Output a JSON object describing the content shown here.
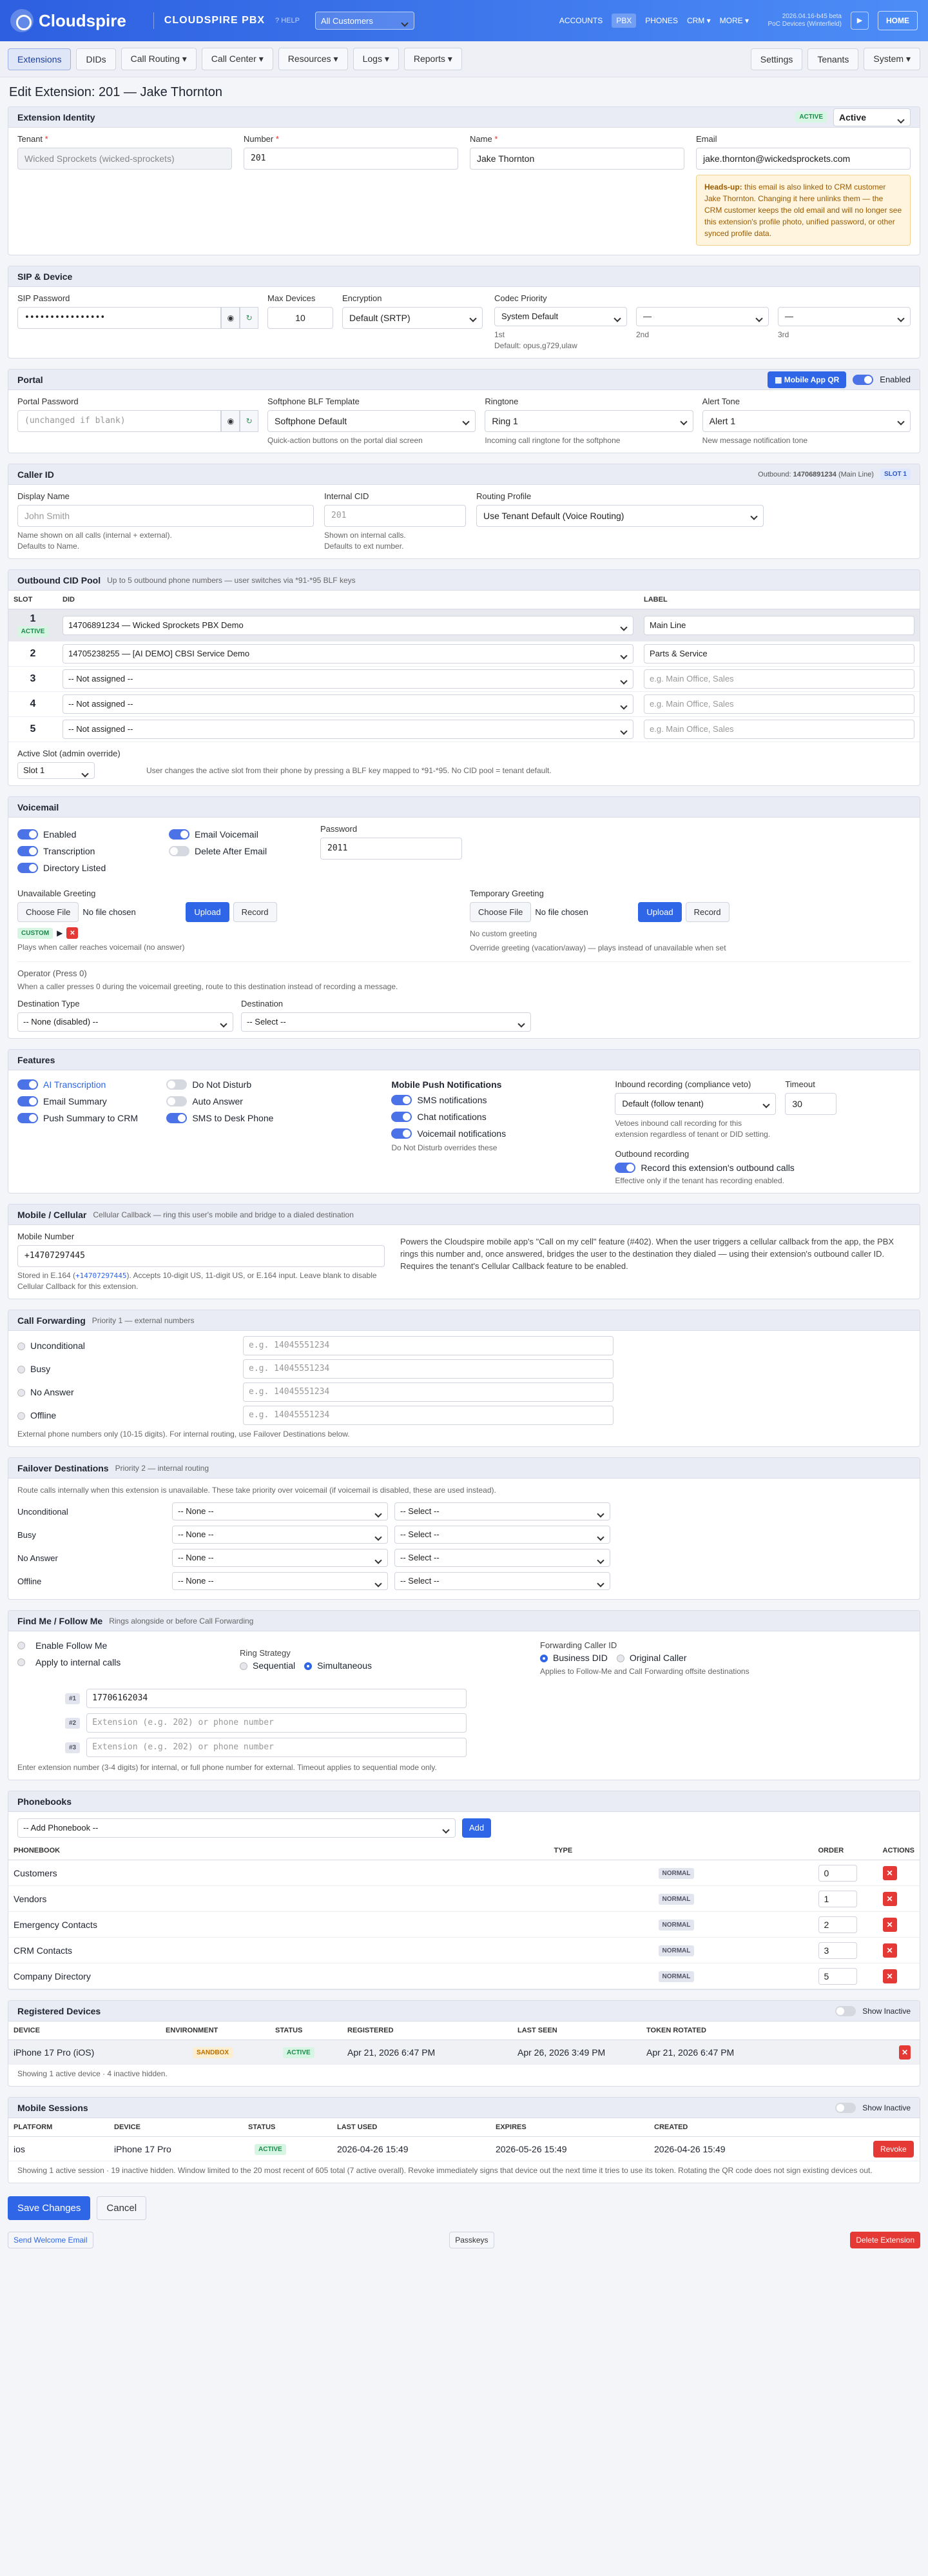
{
  "topbar": {
    "logo": "Cloudspire",
    "app": "CLOUDSPIRE PBX",
    "help": "? HELP",
    "customer": "All Customers",
    "nav": [
      "ACCOUNTS",
      "PBX",
      "PHONES",
      "CRM ▾",
      "MORE ▾"
    ],
    "version_line1": "2026.04.16-b45 beta",
    "version_line2": "PoC Devices (Winterfield)",
    "home": "HOME"
  },
  "subnav": {
    "left": [
      "Extensions",
      "DIDs",
      "Call Routing ▾",
      "Call Center ▾",
      "Resources ▾",
      "Logs ▾",
      "Reports ▾"
    ],
    "right": [
      "Settings",
      "Tenants",
      "System ▾"
    ]
  },
  "page_title": "Edit Extension: 201 — Jake Thornton",
  "identity": {
    "title": "Extension Identity",
    "status_badge": "ACTIVE",
    "status_value": "Active",
    "tenant_label": "Tenant",
    "tenant_value": "Wicked Sprockets (wicked-sprockets)",
    "number_label": "Number",
    "number_value": "201",
    "name_label": "Name",
    "name_value": "Jake Thornton",
    "email_label": "Email",
    "email_value": "jake.thornton@wickedsprockets.com",
    "warn_lead": "Heads-up:",
    "warn_text": "this email is also linked to CRM customer Jake Thornton. Changing it here unlinks them — the CRM customer keeps the old email and will no longer see this extension's profile photo, unified password, or other synced profile data."
  },
  "sip": {
    "title": "SIP & Device",
    "pwd_label": "SIP Password",
    "pwd_value": "••••••••••••••••",
    "max_label": "Max Devices",
    "max_value": "10",
    "enc_label": "Encryption",
    "enc_value": "Default (SRTP)",
    "codec_label": "Codec Priority",
    "codec1": "System Default",
    "codec2": "—",
    "codec3": "—",
    "c1": "1st",
    "c2": "2nd",
    "c3": "3rd",
    "codec_default": "Default: opus,g729,ulaw"
  },
  "portal": {
    "title": "Portal",
    "qr": "Mobile App QR",
    "enabled": "Enabled",
    "pwd_label": "Portal Password",
    "pwd_ph": "(unchanged if blank)",
    "blf_label": "Softphone BLF Template",
    "blf_value": "Softphone Default",
    "blf_hint": "Quick-action buttons on the portal dial screen",
    "ring_label": "Ringtone",
    "ring_value": "Ring 1",
    "ring_hint": "Incoming call ringtone for the softphone",
    "alert_label": "Alert Tone",
    "alert_value": "Alert 1",
    "alert_hint": "New message notification tone"
  },
  "callerid": {
    "title": "Caller ID",
    "outbound_prefix": "Outbound:",
    "outbound_num": "14706891234",
    "outbound_suffix": "(Main Line)",
    "slot": "SLOT 1",
    "disp_label": "Display Name",
    "disp_ph": "John Smith",
    "disp_hint1": "Name shown on all calls (internal + external).",
    "disp_hint2": "Defaults to Name.",
    "int_label": "Internal CID",
    "int_ph": "201",
    "int_hint1": "Shown on internal calls.",
    "int_hint2": "Defaults to ext number.",
    "route_label": "Routing Profile",
    "route_value": "Use Tenant Default (Voice Routing)"
  },
  "cidpool": {
    "title": "Outbound CID Pool",
    "subtitle": "Up to 5 outbound phone numbers — user switches via *91-*95 BLF keys",
    "headers": [
      "SLOT",
      "DID",
      "LABEL"
    ],
    "active_badge": "ACTIVE",
    "rows": [
      {
        "slot": "1",
        "did": "14706891234 — Wicked Sprockets PBX Demo",
        "label": "Main Line",
        "ph": false
      },
      {
        "slot": "2",
        "did": "14705238255 — [AI DEMO] CBSI Service Demo",
        "label": "Parts & Service",
        "ph": false
      },
      {
        "slot": "3",
        "did": "-- Not assigned --",
        "label": "e.g. Main Office, Sales",
        "ph": true
      },
      {
        "slot": "4",
        "did": "-- Not assigned --",
        "label": "e.g. Main Office, Sales",
        "ph": true
      },
      {
        "slot": "5",
        "did": "-- Not assigned --",
        "label": "e.g. Main Office, Sales",
        "ph": true
      }
    ],
    "active_label": "Active Slot (admin override)",
    "active_value": "Slot 1",
    "active_hint": "User changes the active slot from their phone by pressing a BLF key mapped to *91-*95. No CID pool = tenant default."
  },
  "voicemail": {
    "title": "Voicemail",
    "t_enabled": "Enabled",
    "t_trans": "Transcription",
    "t_dir": "Directory Listed",
    "t_email": "Email Voicemail",
    "t_delete": "Delete After Email",
    "pwd_label": "Password",
    "pwd_value": "2011",
    "un_label": "Unavailable Greeting",
    "choose": "Choose File",
    "nofile": "No file chosen",
    "upload": "Upload",
    "record": "Record",
    "custom": "CUSTOM",
    "un_hint": "Plays when caller reaches voicemail (no answer)",
    "tmp_label": "Temporary Greeting",
    "tmp_none": "No custom greeting",
    "tmp_hint": "Override greeting (vacation/away) — plays instead of unavailable when set",
    "op_title": "Operator (Press 0)",
    "op_hint": "When a caller presses 0 during the voicemail greeting, route to this destination instead of recording a message.",
    "dt_label": "Destination Type",
    "dt_value": "-- None (disabled) --",
    "d_label": "Destination",
    "d_value": "-- Select --"
  },
  "features": {
    "title": "Features",
    "f_ai": "AI Transcription",
    "f_summary": "Email Summary",
    "f_push": "Push Summary to CRM",
    "f_dnd": "Do Not Disturb",
    "f_auto": "Auto Answer",
    "f_sms": "SMS to Desk Phone",
    "mp_title": "Mobile Push Notifications",
    "mp_sms": "SMS notifications",
    "mp_chat": "Chat notifications",
    "mp_vm": "Voicemail notifications",
    "mp_hint": "Do Not Disturb overrides these",
    "ir_label": "Inbound recording (compliance veto)",
    "ir_value": "Default (follow tenant)",
    "ir_hint": "Vetoes inbound call recording for this extension regardless of tenant or DID setting.",
    "to_label": "Timeout",
    "to_value": "30",
    "or_label": "Outbound recording",
    "or_toggle": "Record this extension's outbound calls",
    "or_hint": "Effective only if the tenant has recording enabled."
  },
  "mobile": {
    "title": "Mobile / Cellular",
    "subtitle": "Cellular Callback — ring this user's mobile and bridge to a dialed destination",
    "num_label": "Mobile Number",
    "num_value": "+14707297445",
    "stored_a": "Stored in E.164 (",
    "stored_code": "+14707297445",
    "stored_b": "). Accepts 10-digit US, 11-digit US, or E.164 input. Leave blank to disable Cellular Callback for this extension.",
    "desc": "Powers the Cloudspire mobile app's \"Call on my cell\" feature (#402). When the user triggers a cellular callback from the app, the PBX rings this number and, once answered, bridges the user to the destination they dialed — using their extension's outbound caller ID. Requires the tenant's Cellular Callback feature to be enabled."
  },
  "forwarding": {
    "title": "Call Forwarding",
    "subtitle": "Priority 1 — external numbers",
    "rows": [
      "Unconditional",
      "Busy",
      "No Answer",
      "Offline"
    ],
    "ph": "e.g. 14045551234",
    "hint": "External phone numbers only (10-15 digits). For internal routing, use Failover Destinations below."
  },
  "failover": {
    "title": "Failover Destinations",
    "subtitle": "Priority 2 — internal routing",
    "intro": "Route calls internally when this extension is unavailable. These take priority over voicemail (if voicemail is disabled, these are used instead).",
    "rows": [
      "Unconditional",
      "Busy",
      "No Answer",
      "Offline"
    ],
    "none": "-- None --",
    "select": "-- Select --"
  },
  "findme": {
    "title": "Find Me / Follow Me",
    "subtitle": "Rings alongside or before Call Forwarding",
    "enable": "Enable Follow Me",
    "internal": "Apply to internal calls",
    "strategy_label": "Ring Strategy",
    "seq": "Sequential",
    "sim": "Simultaneous",
    "fcid_label": "Forwarding Caller ID",
    "fcid_business": "Business DID",
    "fcid_orig": "Original Caller",
    "fcid_hint": "Applies to Follow-Me and Call Forwarding offsite destinations",
    "dests": [
      {
        "n": "#1",
        "v": "17706162034",
        "ph": false
      },
      {
        "n": "#2",
        "v": "Extension (e.g. 202) or phone number",
        "ph": true
      },
      {
        "n": "#3",
        "v": "Extension (e.g. 202) or phone number",
        "ph": true
      }
    ],
    "hint": "Enter extension number (3-4 digits) for internal, or full phone number for external. Timeout applies to sequential mode only."
  },
  "phonebooks": {
    "title": "Phonebooks",
    "add_select": "-- Add Phonebook --",
    "add": "Add",
    "headers": [
      "PHONEBOOK",
      "TYPE",
      "ORDER",
      "ACTIONS"
    ],
    "rows": [
      {
        "name": "Customers",
        "type": "NORMAL",
        "order": "0"
      },
      {
        "name": "Vendors",
        "type": "NORMAL",
        "order": "1"
      },
      {
        "name": "Emergency Contacts",
        "type": "NORMAL",
        "order": "2"
      },
      {
        "name": "CRM Contacts",
        "type": "NORMAL",
        "order": "3"
      },
      {
        "name": "Company Directory",
        "type": "NORMAL",
        "order": "5"
      }
    ]
  },
  "devices": {
    "title": "Registered Devices",
    "show_inactive": "Show Inactive",
    "headers": [
      "DEVICE",
      "ENVIRONMENT",
      "STATUS",
      "REGISTERED",
      "LAST SEEN",
      "TOKEN ROTATED"
    ],
    "row": {
      "device": "iPhone 17 Pro (iOS)",
      "env": "SANDBOX",
      "status": "ACTIVE",
      "registered": "Apr 21, 2026 6:47 PM",
      "last_seen": "Apr 26, 2026 3:49 PM",
      "rotated": "Apr 21, 2026 6:47 PM"
    },
    "summary": "Showing 1 active device · 4 inactive hidden."
  },
  "sessions": {
    "title": "Mobile Sessions",
    "show_inactive": "Show Inactive",
    "headers": [
      "PLATFORM",
      "DEVICE",
      "STATUS",
      "LAST USED",
      "EXPIRES",
      "CREATED"
    ],
    "row": {
      "platform": "ios",
      "device": "iPhone 17 Pro",
      "status": "ACTIVE",
      "last_used": "2026-04-26 15:49",
      "expires": "2026-05-26 15:49",
      "created": "2026-04-26 15:49"
    },
    "revoke": "Revoke",
    "summary": "Showing 1 active session · 19 inactive hidden. Window limited to the 20 most recent of 605 total (7 active overall). Revoke immediately signs that device out the next time it tries to use its token. Rotating the QR code does not sign existing devices out."
  },
  "footer": {
    "save": "Save Changes",
    "cancel": "Cancel",
    "welcome": "Send Welcome Email",
    "passkeys": "Passkeys",
    "delete": "Delete Extension"
  }
}
